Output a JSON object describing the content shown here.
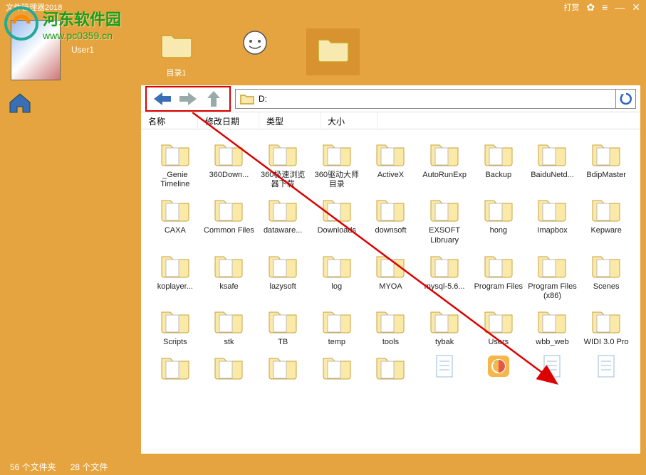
{
  "title": "文件管理器2018",
  "watermark": {
    "name": "河东软件园",
    "url": "www.pc0359.cn"
  },
  "titlebar": {
    "reward": "打赏"
  },
  "user": {
    "name": "User1"
  },
  "tabs": [
    {
      "label": "目录1",
      "kind": "folder"
    },
    {
      "label": "",
      "kind": "chat"
    },
    {
      "label": "",
      "kind": "folder",
      "active": true
    }
  ],
  "path": {
    "value": "D:"
  },
  "columns": {
    "name": "名称",
    "modified": "修改日期",
    "type": "类型",
    "size": "大小"
  },
  "items": [
    {
      "label": "_Genie Timeline"
    },
    {
      "label": "360Down..."
    },
    {
      "label": "360极速浏览器下载"
    },
    {
      "label": "360驱动大师目录"
    },
    {
      "label": "ActiveX"
    },
    {
      "label": "AutoRunExp"
    },
    {
      "label": "Backup"
    },
    {
      "label": "BaiduNetd..."
    },
    {
      "label": "BdipMaster"
    },
    {
      "label": "CAXA"
    },
    {
      "label": "Common Files"
    },
    {
      "label": "dataware..."
    },
    {
      "label": "Downloads"
    },
    {
      "label": "downsoft"
    },
    {
      "label": "EXSOFT Libruary"
    },
    {
      "label": "hong"
    },
    {
      "label": "Imapbox"
    },
    {
      "label": "Kepware"
    },
    {
      "label": "koplayer..."
    },
    {
      "label": "ksafe"
    },
    {
      "label": "lazysoft"
    },
    {
      "label": "log"
    },
    {
      "label": "MYOA"
    },
    {
      "label": "mysql-5.6..."
    },
    {
      "label": "Program Files"
    },
    {
      "label": "Program Files (x86)"
    },
    {
      "label": "Scenes"
    },
    {
      "label": "Scripts"
    },
    {
      "label": "stk"
    },
    {
      "label": "TB"
    },
    {
      "label": "temp"
    },
    {
      "label": "tools"
    },
    {
      "label": "tybak"
    },
    {
      "label": "Users"
    },
    {
      "label": "wbb_web"
    },
    {
      "label": "WIDI 3.0 Pro"
    },
    {
      "label": ""
    },
    {
      "label": ""
    },
    {
      "label": ""
    },
    {
      "label": ""
    },
    {
      "label": ""
    },
    {
      "label": "",
      "doc": true
    },
    {
      "label": "",
      "app": true
    },
    {
      "label": "",
      "doc": true
    },
    {
      "label": "",
      "doc": true
    }
  ],
  "status": {
    "folders": "56 个文件夹",
    "files": "28 个文件"
  }
}
